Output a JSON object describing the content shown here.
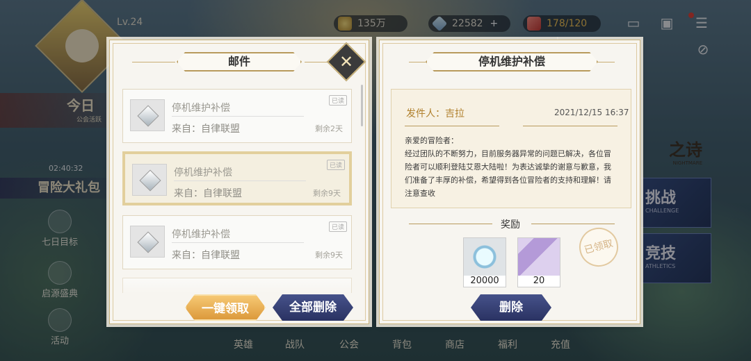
{
  "hud": {
    "level": "Lv.24",
    "gold": "135万",
    "gems": "22582",
    "stamina": "178/120",
    "plus": "+"
  },
  "side_menu": {
    "today": "今日",
    "today_sub": "公会活跃",
    "timer": "02:40:32",
    "adventure_pack": "冒险大礼包",
    "seven_day": "七日目标",
    "origin": "启源盛典",
    "activity": "活动"
  },
  "right_menu": {
    "challenge": "挑战",
    "challenge_sub": "CHALLENGE",
    "arena": "竞技",
    "arena_sub": "ATHLETICS",
    "event_text": "之诗",
    "event_sub": "NIGHTMARE"
  },
  "bottom_tabs": [
    "英雄",
    "战队",
    "公会",
    "背包",
    "商店",
    "福利",
    "充值"
  ],
  "mail_panel": {
    "title": "邮件",
    "close_icon": "close-x-icon",
    "items": [
      {
        "title": "停机维护补偿",
        "from": "来自：自律联盟",
        "remaining": "剩余2天",
        "status": "已读"
      },
      {
        "title": "停机维护补偿",
        "from": "来自：自律联盟",
        "remaining": "剩余9天",
        "status": "已读"
      },
      {
        "title": "停机维护补偿",
        "from": "来自：自律联盟",
        "remaining": "剩余9天",
        "status": "已读"
      }
    ],
    "claim_all": "一键领取",
    "delete_all": "全部删除"
  },
  "detail_panel": {
    "title": "停机维护补偿",
    "sender": "发件人：吉拉",
    "date": "2021/12/15 16:37",
    "greeting": "亲爱的冒险者：",
    "body": "经过团队的不断努力，目前服务器异常的问题已解决，各位冒险者可以顺利登陆艾恩大陆啦！为表达诚挚的谢意与歉意，我们准备了丰厚的补偿，希望得到各位冒险者的支持和理解！请注意查收",
    "rewards_title": "奖励",
    "rewards": [
      {
        "icon": "diamond-icon",
        "count": "20000"
      },
      {
        "icon": "summon-scroll-icon",
        "count": "20"
      }
    ],
    "claimed_stamp": "已领取",
    "delete": "删除"
  },
  "colors": {
    "accent_gold": "#b89a5c",
    "button_gold": "#e7ad55",
    "button_navy": "#36406f",
    "panel_bg": "#f7f5f0"
  }
}
